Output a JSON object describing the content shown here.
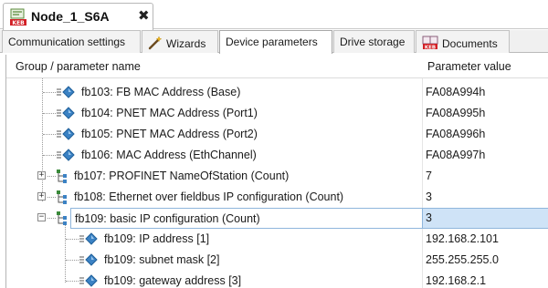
{
  "document_tab": {
    "title": "Node_1_S6A",
    "close_glyph": "✖",
    "icon": "keb-node-icon"
  },
  "tabs": [
    {
      "label": "Communication settings",
      "icon": null,
      "active": false
    },
    {
      "label": "Wizards",
      "icon": "magic-wand-icon",
      "active": false
    },
    {
      "label": "Device parameters",
      "icon": null,
      "active": true
    },
    {
      "label": "Drive storage",
      "icon": null,
      "active": false
    },
    {
      "label": "Documents",
      "icon": "keb-book-icon",
      "active": false
    }
  ],
  "grid": {
    "columns": {
      "name": "Group / parameter name",
      "value": "Parameter value"
    },
    "rows": [
      {
        "name": "fb103: FB MAC Address (Base)",
        "value": "FA08A994h",
        "kind": "param"
      },
      {
        "name": "fb104: PNET MAC Address (Port1)",
        "value": "FA08A995h",
        "kind": "param"
      },
      {
        "name": "fb105: PNET MAC Address (Port2)",
        "value": "FA08A996h",
        "kind": "param"
      },
      {
        "name": "fb106: MAC Address (EthChannel)",
        "value": "FA08A997h",
        "kind": "param"
      },
      {
        "name": "fb107: PROFINET NameOfStation (Count)",
        "value": "7",
        "kind": "group",
        "expander": "+"
      },
      {
        "name": "fb108: Ethernet over fieldbus IP configuration (Count)",
        "value": "3",
        "kind": "group",
        "expander": "+"
      },
      {
        "name": "fb109: basic IP configuration (Count)",
        "value": "3",
        "kind": "group",
        "expander": "−",
        "selected": true
      },
      {
        "name": "fb109: IP address [1]",
        "value": "192.168.2.101",
        "kind": "child"
      },
      {
        "name": "fb109: subnet mask [2]",
        "value": "255.255.255.0",
        "kind": "child"
      },
      {
        "name": "fb109: gateway address [3]",
        "value": "192.168.2.1",
        "kind": "child"
      }
    ]
  },
  "colors": {
    "selection_fill": "#cfe3f7",
    "selection_border": "#8fb6dc",
    "param_icon_blue": "#3b82c4"
  }
}
